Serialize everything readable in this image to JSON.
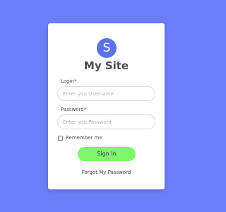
{
  "site": {
    "logo_letter": "S",
    "title": "My Site"
  },
  "login_field": {
    "label": "Login*",
    "placeholder": "Enter you Username",
    "value": ""
  },
  "password_field": {
    "label": "Password*",
    "placeholder": "Enter you Password",
    "value": ""
  },
  "remember": {
    "label": "Remember me",
    "checked": false
  },
  "actions": {
    "signin_label": "Sign In",
    "forgot_label": "Forgot My Password"
  },
  "colors": {
    "background": "#6b7ef7",
    "logo": "#5b73e8",
    "signin_button": "#7ef76b",
    "card": "#ffffff"
  },
  "icons": {
    "logo": "site-logo-icon",
    "checkbox": "checkbox-icon"
  }
}
